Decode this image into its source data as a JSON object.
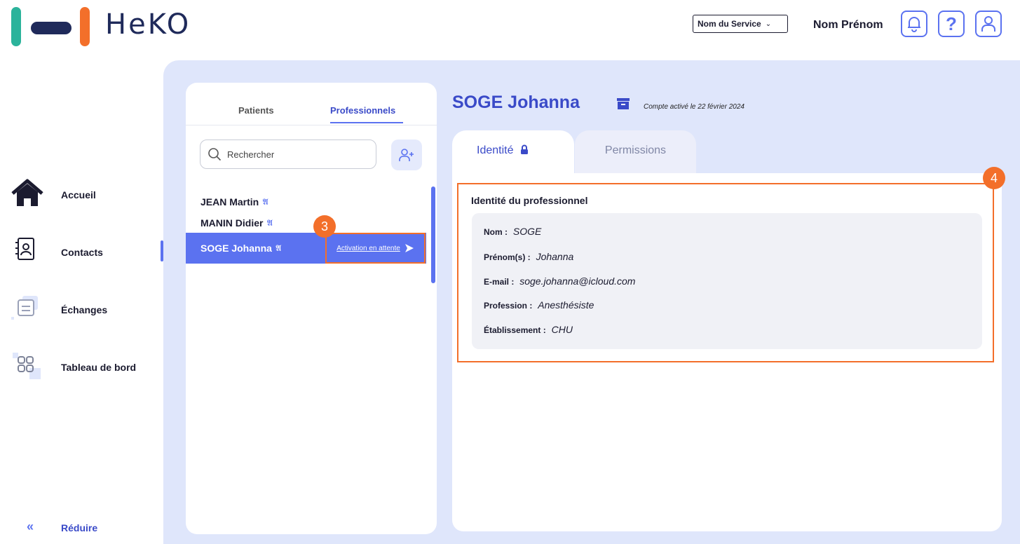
{
  "app": {
    "logo_text": "HeKO"
  },
  "header": {
    "service_select": "Nom du Service",
    "user_name": "Nom Prénom",
    "help_glyph": "?"
  },
  "sidebar": {
    "items": [
      {
        "label": "Accueil",
        "icon": "home-icon"
      },
      {
        "label": "Contacts",
        "icon": "contacts-icon",
        "active": true
      },
      {
        "label": "Échanges",
        "icon": "exchanges-icon"
      },
      {
        "label": "Tableau de bord",
        "icon": "dashboard-icon"
      }
    ],
    "reduce_glyph": "«",
    "reduce_label": "Réduire"
  },
  "contacts": {
    "tabs": [
      "Patients",
      "Professionnels"
    ],
    "active_tab": "Professionnels",
    "search_placeholder": "Rechercher",
    "list": [
      {
        "name": "JEAN Martin"
      },
      {
        "name": "MANIN Didier"
      },
      {
        "name": "SOGE Johanna",
        "selected": true,
        "status": "Activation en attente"
      }
    ]
  },
  "detail": {
    "title": "SOGE Johanna",
    "activated_note": "Compte activé le 22 février 2024",
    "tabs": [
      "Identité",
      "Permissions"
    ],
    "section_title": "Identité du professionnel",
    "fields": [
      {
        "label": "Nom :",
        "value": "SOGE"
      },
      {
        "label": "Prénom(s) :",
        "value": "Johanna"
      },
      {
        "label": "E-mail :",
        "value": "soge.johanna@icloud.com"
      },
      {
        "label": "Profession :",
        "value": "Anesthésiste"
      },
      {
        "label": "Établissement :",
        "value": "CHU"
      }
    ]
  },
  "annotations": {
    "step_a": "3",
    "step_b": "4"
  },
  "colors": {
    "accent": "#5b72f0",
    "highlight": "#f36f2a",
    "background": "#dfe6fb",
    "brand_teal": "#2bb39b",
    "brand_navy": "#1f2a5a"
  }
}
